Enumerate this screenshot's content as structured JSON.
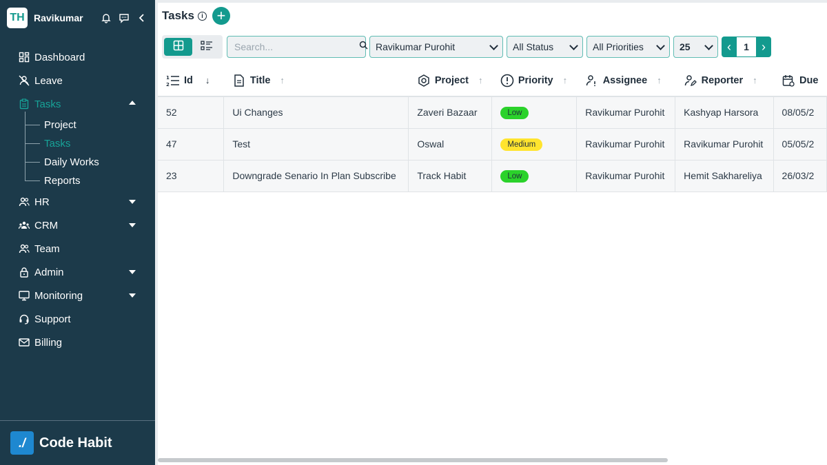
{
  "sidebar": {
    "logo_text": "TH",
    "username": "Ravikumar",
    "nav": [
      {
        "label": "Dashboard",
        "icon": "dashboard-icon"
      },
      {
        "label": "Leave",
        "icon": "leave-icon"
      },
      {
        "label": "Tasks",
        "icon": "tasks-icon"
      },
      {
        "label": "HR",
        "icon": "hr-icon"
      },
      {
        "label": "CRM",
        "icon": "crm-icon"
      },
      {
        "label": "Team",
        "icon": "team-icon"
      },
      {
        "label": "Admin",
        "icon": "lock-icon"
      },
      {
        "label": "Monitoring",
        "icon": "monitor-icon"
      },
      {
        "label": "Support",
        "icon": "headset-icon"
      },
      {
        "label": "Billing",
        "icon": "mail-icon"
      }
    ],
    "tasks_sub": [
      "Project",
      "Tasks",
      "Daily Works",
      "Reports"
    ],
    "brand_mark": "./",
    "brand_name": "Code Habit"
  },
  "header": {
    "title": "Tasks",
    "info_glyph": "i",
    "add_glyph": "+"
  },
  "toolbar": {
    "search_placeholder": "Search...",
    "assignee_filter": "Ravikumar Purohit",
    "status_filter": "All Status",
    "priority_filter": "All Priorities",
    "page_size": "25",
    "current_page": "1",
    "prev_glyph": "‹",
    "next_glyph": "›"
  },
  "table": {
    "columns": [
      "Id",
      "Title",
      "Project",
      "Priority",
      "Assignee",
      "Reporter",
      "Due"
    ],
    "sort_glyph_active": "↓",
    "sort_glyph": "↑",
    "rows": [
      {
        "id": "52",
        "title": "Ui Changes",
        "project": "Zaveri Bazaar",
        "priority": "Low",
        "assignee": "Ravikumar Purohit",
        "reporter": "Kashyap Harsora",
        "due": "08/05/2"
      },
      {
        "id": "47",
        "title": "Test",
        "project": "Oswal",
        "priority": "Medium",
        "assignee": "Ravikumar Purohit",
        "reporter": "Ravikumar Purohit",
        "due": "05/05/2"
      },
      {
        "id": "23",
        "title": "Downgrade Senario In Plan Subscribe",
        "project": "Track Habit",
        "priority": "Low",
        "assignee": "Ravikumar Purohit",
        "reporter": "Hemit Sakhareliya",
        "due": "26/03/2"
      }
    ]
  },
  "colors": {
    "sidebar_bg": "#1c3a4a",
    "accent": "#139a8e",
    "low": "#2bd22b",
    "medium": "#ffe42e"
  }
}
